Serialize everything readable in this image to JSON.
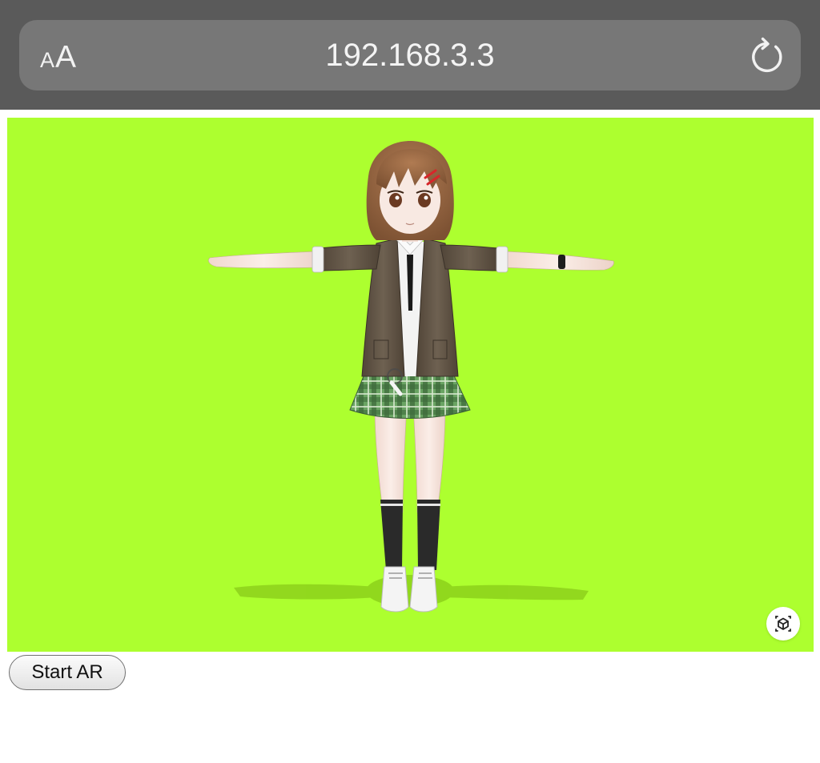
{
  "browser": {
    "text_size_button": {
      "small": "A",
      "large": "A"
    },
    "url": "192.168.3.3",
    "reload_icon": "reload-icon",
    "toolbar_color": "#5a5a5a",
    "urlbar_color": "#777777"
  },
  "viewer": {
    "background_color": "#adff2f",
    "subject": "3D anime-style schoolgirl model in T-pose",
    "ar_icon": "ar-cube-icon"
  },
  "start_ar": {
    "label": "Start AR"
  }
}
